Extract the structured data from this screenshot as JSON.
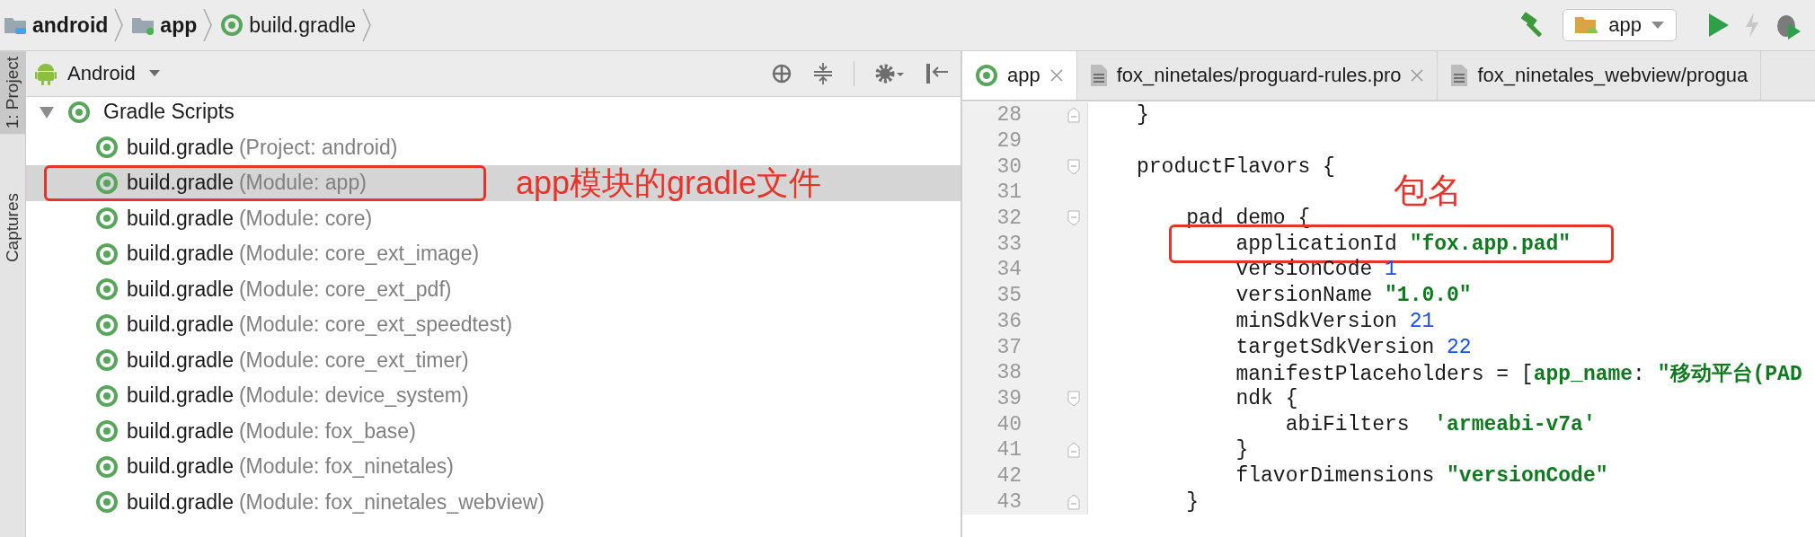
{
  "breadcrumbs": [
    {
      "label": "android",
      "kind": "project"
    },
    {
      "label": "app",
      "kind": "module"
    },
    {
      "label": "build.gradle",
      "kind": "gradle"
    }
  ],
  "toolbar": {
    "run_config": "app"
  },
  "side_tabs": [
    {
      "label": "1: Project",
      "selected": true
    },
    {
      "label": "Captures",
      "selected": false
    }
  ],
  "project_panel": {
    "view": "Android",
    "tree": [
      {
        "label": "Gradle Scripts",
        "expanded": true,
        "children": [
          {
            "name": "build.gradle",
            "detail": "(Project: android)",
            "selected": false,
            "boxed": false
          },
          {
            "name": "build.gradle",
            "detail": "(Module: app)",
            "selected": true,
            "boxed": true,
            "note": "app模块的gradle文件"
          },
          {
            "name": "build.gradle",
            "detail": "(Module: core)",
            "selected": false,
            "boxed": false
          },
          {
            "name": "build.gradle",
            "detail": "(Module: core_ext_image)",
            "selected": false,
            "boxed": false
          },
          {
            "name": "build.gradle",
            "detail": "(Module: core_ext_pdf)",
            "selected": false,
            "boxed": false
          },
          {
            "name": "build.gradle",
            "detail": "(Module: core_ext_speedtest)",
            "selected": false,
            "boxed": false
          },
          {
            "name": "build.gradle",
            "detail": "(Module: core_ext_timer)",
            "selected": false,
            "boxed": false
          },
          {
            "name": "build.gradle",
            "detail": "(Module: device_system)",
            "selected": false,
            "boxed": false
          },
          {
            "name": "build.gradle",
            "detail": "(Module: fox_base)",
            "selected": false,
            "boxed": false
          },
          {
            "name": "build.gradle",
            "detail": "(Module: fox_ninetales)",
            "selected": false,
            "boxed": false
          },
          {
            "name": "build.gradle",
            "detail": "(Module: fox_ninetales_webview)",
            "selected": false,
            "boxed": false
          }
        ]
      }
    ]
  },
  "editor_tabs": [
    {
      "label": "app",
      "kind": "gradle",
      "selected": true,
      "closable": true
    },
    {
      "label": "fox_ninetales/proguard-rules.pro",
      "kind": "file",
      "selected": false,
      "closable": true
    },
    {
      "label": "fox_ninetales_webview/progua",
      "kind": "file",
      "selected": false,
      "closable": false
    }
  ],
  "code": [
    {
      "number": "28",
      "fold_open": false,
      "fold_close": true,
      "segments": [
        {
          "text": "}",
          "kind": "plain"
        }
      ]
    },
    {
      "number": "29",
      "fold_open": false,
      "fold_close": false
    },
    {
      "number": "30",
      "fold_open": true,
      "fold_close": false,
      "segments": [
        {
          "text": "productFlavors {",
          "kind": "plain"
        }
      ]
    },
    {
      "number": "31",
      "fold_open": false,
      "fold_close": false
    },
    {
      "number": "32",
      "fold_open": true,
      "fold_close": false,
      "segments": [
        {
          "text": "    pad_demo {",
          "kind": "plain"
        }
      ]
    },
    {
      "number": "33",
      "fold_open": false,
      "fold_close": false,
      "boxed": true,
      "note": "包名",
      "segments": [
        {
          "text": "        applicationId ",
          "kind": "plain"
        },
        {
          "text": "\"fox.app.pad\"",
          "kind": "string"
        }
      ]
    },
    {
      "number": "34",
      "fold_open": false,
      "fold_close": false,
      "segments": [
        {
          "text": "        versionCode ",
          "kind": "plain"
        },
        {
          "text": "1",
          "kind": "number"
        }
      ]
    },
    {
      "number": "35",
      "fold_open": false,
      "fold_close": false,
      "segments": [
        {
          "text": "        versionName ",
          "kind": "plain"
        },
        {
          "text": "\"1.0.0\"",
          "kind": "string"
        }
      ]
    },
    {
      "number": "36",
      "fold_open": false,
      "fold_close": false,
      "segments": [
        {
          "text": "        minSdkVersion ",
          "kind": "plain"
        },
        {
          "text": "21",
          "kind": "number"
        }
      ]
    },
    {
      "number": "37",
      "fold_open": false,
      "fold_close": false,
      "segments": [
        {
          "text": "        targetSdkVersion ",
          "kind": "plain"
        },
        {
          "text": "22",
          "kind": "number"
        }
      ]
    },
    {
      "number": "38",
      "fold_open": false,
      "fold_close": false,
      "segments": [
        {
          "text": "        manifestPlaceholders = [",
          "kind": "plain"
        },
        {
          "text": "app_name",
          "kind": "string"
        },
        {
          "text": ": ",
          "kind": "plain"
        },
        {
          "text": "\"移动平台(PAD",
          "kind": "string"
        }
      ]
    },
    {
      "number": "39",
      "fold_open": true,
      "fold_close": false,
      "segments": [
        {
          "text": "        ndk {",
          "kind": "plain"
        }
      ]
    },
    {
      "number": "40",
      "fold_open": false,
      "fold_close": false,
      "segments": [
        {
          "text": "            abiFilters  ",
          "kind": "plain"
        },
        {
          "text": "'armeabi-v7a'",
          "kind": "string"
        }
      ]
    },
    {
      "number": "41",
      "fold_open": false,
      "fold_close": true,
      "segments": [
        {
          "text": "        }",
          "kind": "plain"
        }
      ]
    },
    {
      "number": "42",
      "fold_open": false,
      "fold_close": false,
      "segments": [
        {
          "text": "        flavorDimensions ",
          "kind": "plain"
        },
        {
          "text": "\"versionCode\"",
          "kind": "string"
        }
      ]
    },
    {
      "number": "43",
      "fold_open": false,
      "fold_close": true,
      "segments": [
        {
          "text": "    }",
          "kind": "plain"
        }
      ]
    }
  ]
}
